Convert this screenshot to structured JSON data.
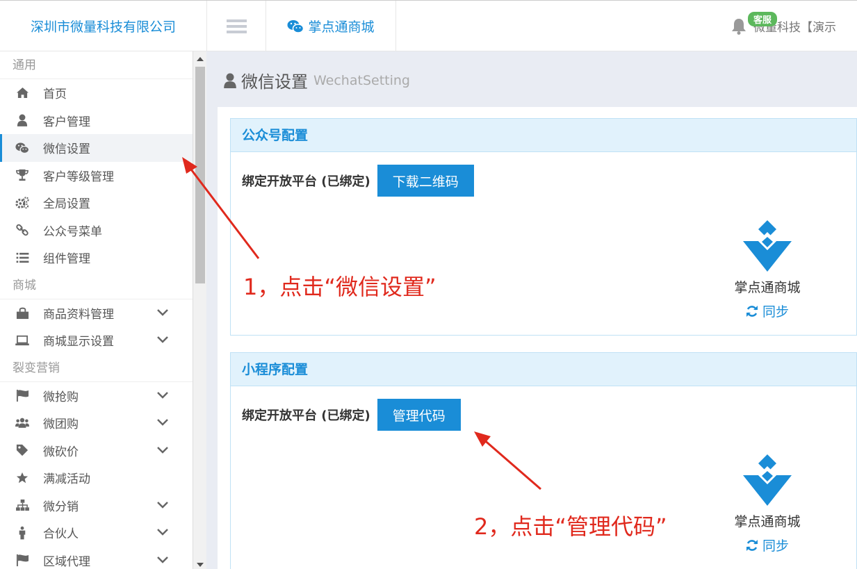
{
  "header": {
    "brand": "深圳市微量科技有限公司",
    "app_tab": "掌点通商城",
    "kf_badge": "客服",
    "user_name": "微量科技【演示"
  },
  "sidebar": {
    "sections": [
      {
        "title": "通用",
        "items": [
          {
            "label": "首页",
            "icon": "home-icon"
          },
          {
            "label": "客户管理",
            "icon": "user-icon"
          },
          {
            "label": "微信设置",
            "icon": "wechat-icon",
            "active": true
          },
          {
            "label": "客户等级管理",
            "icon": "trophy-icon"
          },
          {
            "label": "全局设置",
            "icon": "gears-icon"
          },
          {
            "label": "公众号菜单",
            "icon": "link-icon"
          },
          {
            "label": "组件管理",
            "icon": "list-icon"
          }
        ]
      },
      {
        "title": "商城",
        "items": [
          {
            "label": "商品资料管理",
            "icon": "shopping-bag-icon",
            "expandable": true
          },
          {
            "label": "商城显示设置",
            "icon": "laptop-icon",
            "expandable": true
          }
        ]
      },
      {
        "title": "裂变营销",
        "items": [
          {
            "label": "微抢购",
            "icon": "flag-icon",
            "expandable": true
          },
          {
            "label": "微团购",
            "icon": "users-icon",
            "expandable": true
          },
          {
            "label": "微砍价",
            "icon": "tag-icon",
            "expandable": true
          },
          {
            "label": "满减活动",
            "icon": "star-icon"
          },
          {
            "label": "微分销",
            "icon": "sitemap-icon",
            "expandable": true
          },
          {
            "label": "合伙人",
            "icon": "person-icon",
            "expandable": true
          },
          {
            "label": "区域代理",
            "icon": "flag-icon",
            "expandable": true
          }
        ]
      }
    ]
  },
  "page": {
    "title": "微信设置",
    "subtitle": "WechatSetting"
  },
  "panels": [
    {
      "title": "公众号配置",
      "bind_label": "绑定开放平台 (已绑定)",
      "button": "下载二维码",
      "app_name": "掌点通商城",
      "sync": "同步"
    },
    {
      "title": "小程序配置",
      "bind_label": "绑定开放平台 (已绑定)",
      "button": "管理代码",
      "app_name": "掌点通商城",
      "sync": "同步"
    }
  ],
  "annotations": {
    "step1": "1，点击“微信设置”",
    "step2": "2，点击“管理代码”"
  },
  "colors": {
    "accent": "#1a8dd7",
    "annotation": "#e0291d",
    "badge": "#5cb85c"
  }
}
